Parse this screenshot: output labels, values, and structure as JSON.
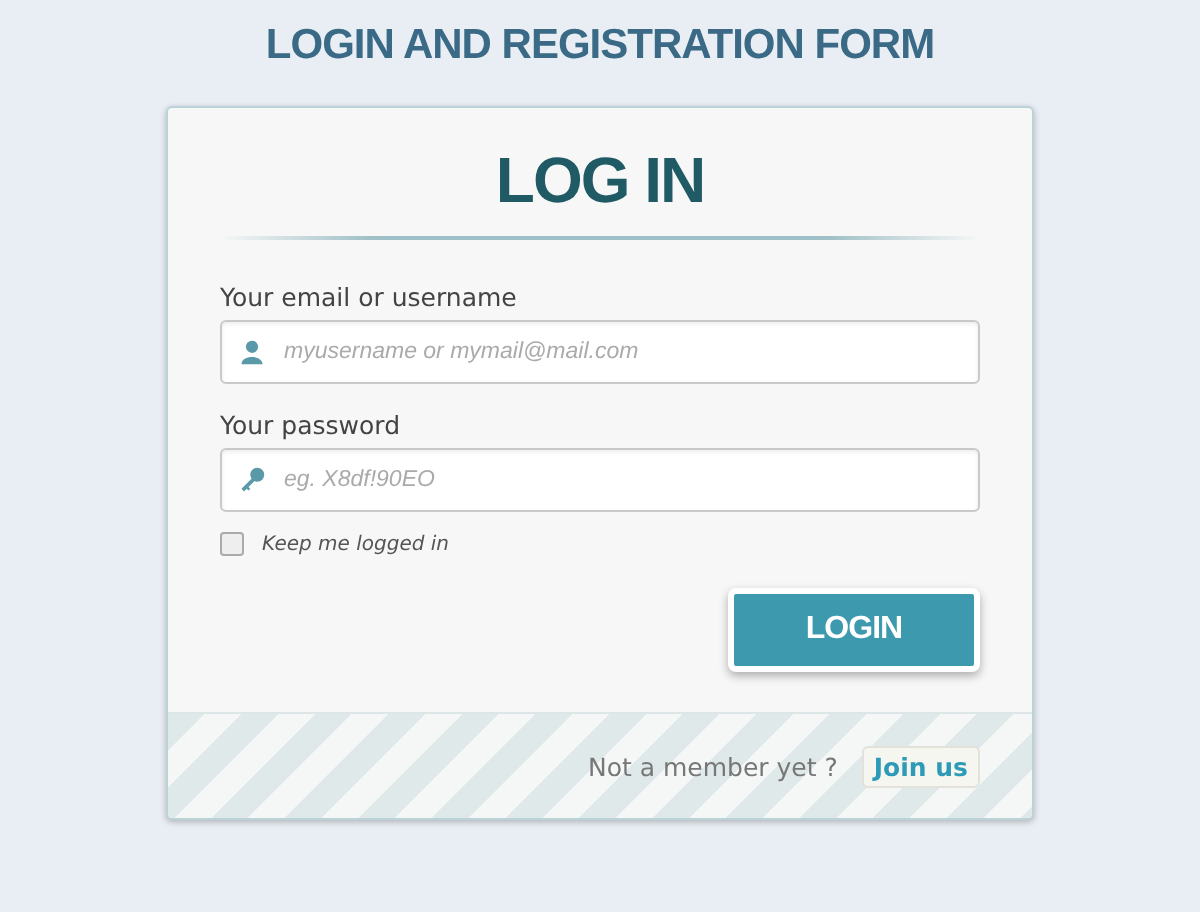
{
  "page_title": "LOGIN AND REGISTRATION FORM",
  "form": {
    "heading": "LOG IN",
    "fields": [
      {
        "kind": "user",
        "label": "Your email or username",
        "placeholder": "myusername or mymail@mail.com"
      },
      {
        "kind": "key",
        "label": "Your password",
        "placeholder": "eg. X8df!90EO"
      }
    ],
    "remember": {
      "label": "Keep me logged in",
      "checked": false
    },
    "submit": "LOGIN"
  },
  "footer": {
    "text": "Not a member yet ?",
    "link": "Join us"
  }
}
